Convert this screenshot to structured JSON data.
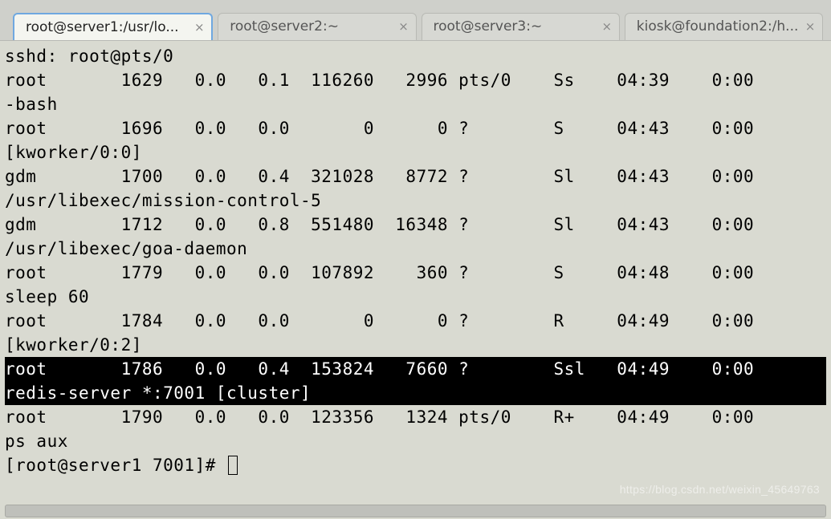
{
  "tabs": [
    {
      "label": "root@server1:/usr/lo...",
      "active": true
    },
    {
      "label": "root@server2:~",
      "active": false
    },
    {
      "label": "root@server3:~",
      "active": false
    },
    {
      "label": "kiosk@foundation2:/h...",
      "active": false
    }
  ],
  "processes": [
    {
      "line1": "sshd: root@pts/0",
      "row": null
    },
    {
      "user": "root",
      "pid": "1629",
      "cpu": "0.0",
      "mem": "0.1",
      "vsz": "116260",
      "rss": "2996",
      "tty": "pts/0",
      "stat": "Ss",
      "start": "04:39",
      "time": "0:00",
      "cmd": "-bash",
      "hl": false
    },
    {
      "user": "root",
      "pid": "1696",
      "cpu": "0.0",
      "mem": "0.0",
      "vsz": "0",
      "rss": "0",
      "tty": "?",
      "stat": "S",
      "start": "04:43",
      "time": "0:00",
      "cmd": "[kworker/0:0]",
      "hl": false
    },
    {
      "user": "gdm",
      "pid": "1700",
      "cpu": "0.0",
      "mem": "0.4",
      "vsz": "321028",
      "rss": "8772",
      "tty": "?",
      "stat": "Sl",
      "start": "04:43",
      "time": "0:00",
      "cmd": "/usr/libexec/mission-control-5",
      "hl": false
    },
    {
      "user": "gdm",
      "pid": "1712",
      "cpu": "0.0",
      "mem": "0.8",
      "vsz": "551480",
      "rss": "16348",
      "tty": "?",
      "stat": "Sl",
      "start": "04:43",
      "time": "0:00",
      "cmd": "/usr/libexec/goa-daemon",
      "hl": false
    },
    {
      "user": "root",
      "pid": "1779",
      "cpu": "0.0",
      "mem": "0.0",
      "vsz": "107892",
      "rss": "360",
      "tty": "?",
      "stat": "S",
      "start": "04:48",
      "time": "0:00",
      "cmd": "sleep 60",
      "hl": false
    },
    {
      "user": "root",
      "pid": "1784",
      "cpu": "0.0",
      "mem": "0.0",
      "vsz": "0",
      "rss": "0",
      "tty": "?",
      "stat": "R",
      "start": "04:49",
      "time": "0:00",
      "cmd": "[kworker/0:2]",
      "hl": false
    },
    {
      "user": "root",
      "pid": "1786",
      "cpu": "0.0",
      "mem": "0.4",
      "vsz": "153824",
      "rss": "7660",
      "tty": "?",
      "stat": "Ssl",
      "start": "04:49",
      "time": "0:00",
      "cmd": "redis-server *:7001 [cluster]",
      "hl": true
    },
    {
      "user": "root",
      "pid": "1790",
      "cpu": "0.0",
      "mem": "0.0",
      "vsz": "123356",
      "rss": "1324",
      "tty": "pts/0",
      "stat": "R+",
      "start": "04:49",
      "time": "0:00",
      "cmd": "ps aux",
      "hl": false
    }
  ],
  "first_line": "sshd: root@pts/0",
  "prompt": "[root@server1 7001]# ",
  "watermark": "https://blog.csdn.net/weixin_45649763",
  "close_glyph": "×"
}
